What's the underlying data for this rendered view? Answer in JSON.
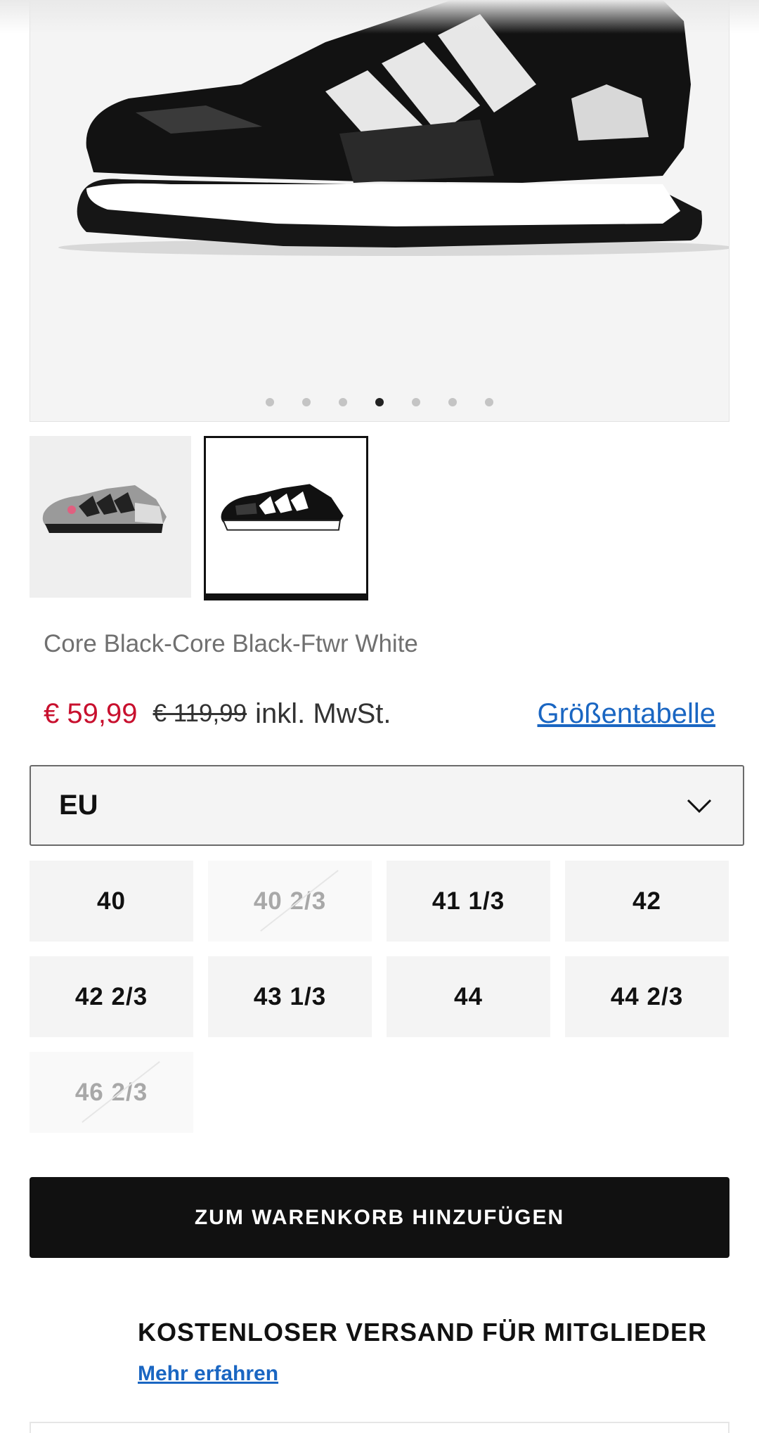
{
  "gallery": {
    "dots_total": 7,
    "active_dot": 4,
    "image_icon": "shoe-main-image"
  },
  "thumbnails": [
    {
      "name": "thumbnail-grey-colorway",
      "selected": false
    },
    {
      "name": "thumbnail-black-colorway",
      "selected": true
    }
  ],
  "product": {
    "colorway": "Core Black-Core Black-Ftwr White",
    "price_sale": "€ 59,99",
    "price_old": "€ 119,99",
    "price_vat": "inkl. MwSt.",
    "size_chart_link": "Größentabelle"
  },
  "size_system": {
    "selected": "EU",
    "icon": "chevron-down-icon"
  },
  "sizes": [
    {
      "label": "40",
      "available": true
    },
    {
      "label": "40 2/3",
      "available": false
    },
    {
      "label": "41 1/3",
      "available": true
    },
    {
      "label": "42",
      "available": true
    },
    {
      "label": "42 2/3",
      "available": true
    },
    {
      "label": "43 1/3",
      "available": true
    },
    {
      "label": "44",
      "available": true
    },
    {
      "label": "44 2/3",
      "available": true
    },
    {
      "label": "46 2/3",
      "available": false
    }
  ],
  "cart": {
    "button_label": "ZUM WARENKORB HINZUFÜGEN"
  },
  "promo": {
    "title": "KOSTENLOSER VERSAND FÜR MITGLIEDER",
    "link": "Mehr erfahren"
  },
  "colors": {
    "sale_price": "#c8102e",
    "link": "#1a66c2",
    "button_bg": "#111111"
  }
}
